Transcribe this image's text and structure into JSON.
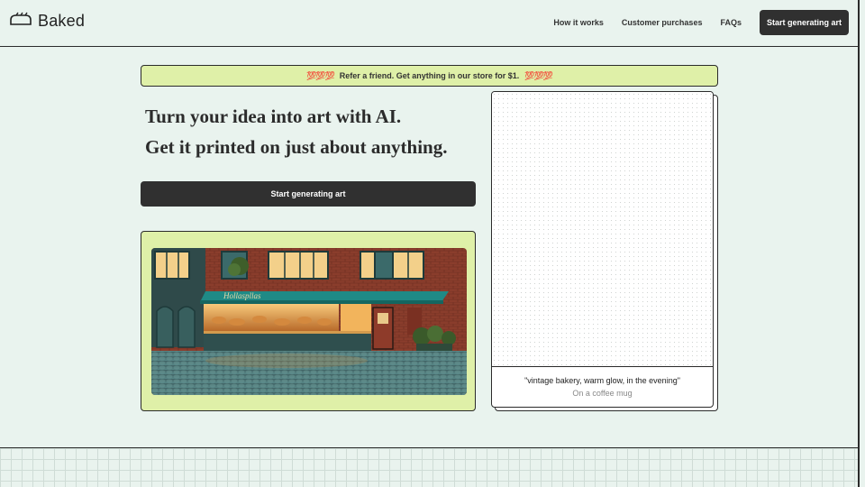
{
  "header": {
    "brand": "Baked",
    "nav": [
      "How it works",
      "Customer purchases",
      "FAQs"
    ],
    "cta_label": "Start generating art"
  },
  "banner": {
    "emoji_left": "💯💯💯",
    "text": "Refer a friend. Get anything in our store for $1.",
    "emoji_right": "💯💯💯"
  },
  "hero": {
    "line1": "Turn your idea into art with AI.",
    "line2": "Get it printed on just about anything.",
    "cta_label": "Start generating art"
  },
  "preview": {
    "prompt": "\"vintage bakery, warm glow, in the evening\"",
    "product": "On a coffee mug"
  },
  "colors": {
    "background": "#e9f3ee",
    "accent_green": "#dff0a8",
    "dark_button": "#303030"
  },
  "icons": [
    "bread-logo-icon"
  ]
}
